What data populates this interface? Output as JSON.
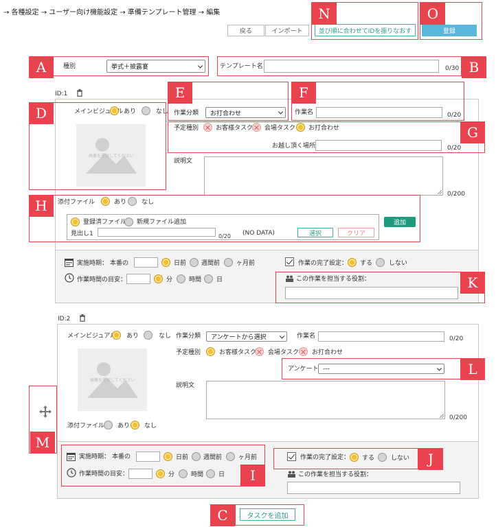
{
  "breadcrumb": "→ 各種設定 → ユーザー向け機能設定 → 準備テンプレート管理 → 編集",
  "toolbar": {
    "back": "戻る",
    "import": "インポート",
    "reorder": "並び順に合わせてIDを振りなおす",
    "register": "登録"
  },
  "form": {
    "type_label": "種別",
    "type_value": "挙式＋披露宴",
    "template_name_label": "テンプレート名",
    "template_name_count": "0/30"
  },
  "task1": {
    "id": "ID:1",
    "main_visual_label": "メインビジュアル",
    "yes": "あり",
    "no": "なし",
    "image_placeholder": "画像を選択してください",
    "work_category_label": "作業分類",
    "work_category_value": "お打合わせ",
    "work_name_label": "作業名",
    "work_name_count": "0/20",
    "schedule_type_label": "予定種別",
    "customer_task": "お客様タスク",
    "venue_task": "会場タスク",
    "meeting": "お打合わせ",
    "visit_place_label": "お越し頂く場所",
    "visit_place_count": "0/20",
    "description_label": "説明文",
    "description_count": "0/200",
    "attachment_label": "添付ファイル",
    "registered_file": "登録済ファイル",
    "new_file": "新規ファイル追加",
    "heading_label": "見出し1",
    "heading_count": "0/20",
    "no_data": "(NO DATA)",
    "select_btn": "選択",
    "clear_btn": "クリア",
    "add_btn": "追加",
    "timing_label": "実施時期：",
    "timing_prefix": "本番の",
    "days_before": "日前",
    "weeks_before": "週間前",
    "months_before": "ヶ月前",
    "duration_label": "作業時間の目安：",
    "minutes": "分",
    "hours": "時間",
    "days": "日",
    "completion_label": "作業の完了設定：",
    "do": "する",
    "dont": "しない",
    "role_label": "この作業を担当する役割："
  },
  "task2": {
    "id": "ID:2",
    "main_visual_label": "メインビジュアル",
    "yes": "あり",
    "no": "なし",
    "image_placeholder": "画像を選択してください",
    "work_category_label": "作業分類",
    "work_category_value": "アンケートから選択",
    "work_name_label": "作業名",
    "work_name_count": "0/20",
    "schedule_type_label": "予定種別",
    "customer_task": "お客様タスク",
    "venue_task": "会場タスク",
    "meeting": "お打合わせ",
    "survey_label": "アンケート",
    "survey_value": "---",
    "description_label": "説明文",
    "description_count": "0/200",
    "attachment_label": "添付ファイル",
    "timing_label": "実施時期：",
    "timing_prefix": "本番の",
    "days_before": "日前",
    "weeks_before": "週間前",
    "months_before": "ヶ月前",
    "duration_label": "作業時間の目安：",
    "minutes": "分",
    "hours": "時間",
    "days": "日",
    "completion_label": "作業の完了設定：",
    "do": "する",
    "dont": "しない",
    "role_label": "この作業を担当する役割："
  },
  "add_task": "タスクを追加",
  "callouts": {
    "A": "A",
    "B": "B",
    "C": "C",
    "D": "D",
    "E": "E",
    "F": "F",
    "G": "G",
    "H": "H",
    "I": "I",
    "J": "J",
    "K": "K",
    "L": "L",
    "M": "M",
    "N": "N",
    "O": "O"
  },
  "colors": {
    "callout": "#e8434f",
    "radio_on": "#f2c037",
    "teal": "#3bb5a0",
    "register": "#5ab6da",
    "add": "#1f9a7c"
  }
}
